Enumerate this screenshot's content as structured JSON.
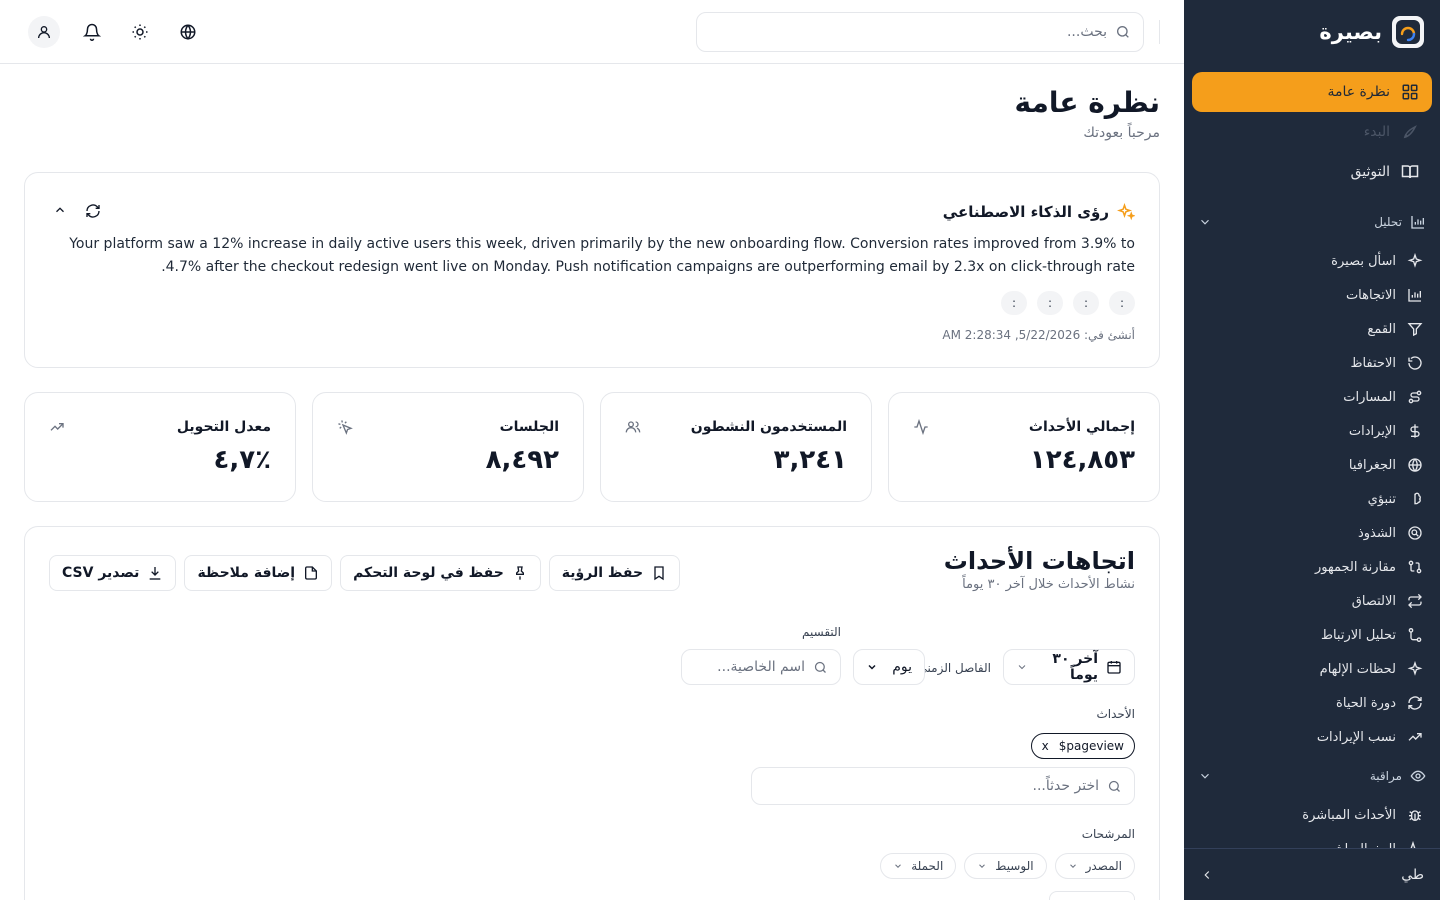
{
  "app": {
    "name": "بصيرة"
  },
  "colors": {
    "accent": "#f59e1b",
    "sidebar_bg": "#1f2a3b"
  },
  "nav": {
    "items": [
      {
        "label": "نظرة عامة",
        "icon": "grid-icon",
        "active": true
      },
      {
        "label": "البدء",
        "icon": "rocket-icon",
        "dim": true
      },
      {
        "label": "التوثيق",
        "icon": "book-icon"
      }
    ],
    "sections": [
      {
        "title": "تحليل",
        "icon": "bar-chart-icon",
        "items": [
          {
            "label": "اسأل بصيرة",
            "icon": "sparkle-icon"
          },
          {
            "label": "الاتجاهات",
            "icon": "bar-chart-icon"
          },
          {
            "label": "القمع",
            "icon": "funnel-icon"
          },
          {
            "label": "الاحتفاظ",
            "icon": "rotate-icon"
          },
          {
            "label": "المسارات",
            "icon": "route-icon"
          },
          {
            "label": "الإيرادات",
            "icon": "dollar-icon"
          },
          {
            "label": "الجغرافيا",
            "icon": "globe-icon"
          },
          {
            "label": "تنبؤي",
            "icon": "brain-icon"
          },
          {
            "label": "الشذوذ",
            "icon": "scan-icon"
          },
          {
            "label": "مقارنة الجمهور",
            "icon": "compare-icon"
          },
          {
            "label": "الالتصاق",
            "icon": "repeat-icon"
          },
          {
            "label": "تحليل الارتباط",
            "icon": "correlation-icon"
          },
          {
            "label": "لحظات الإلهام",
            "icon": "sparkle-icon"
          },
          {
            "label": "دورة الحياة",
            "icon": "refresh-icon"
          },
          {
            "label": "نسب الإيرادات",
            "icon": "trending-up-icon"
          }
        ]
      },
      {
        "title": "مراقبة",
        "icon": "eye-icon",
        "items": [
          {
            "label": "الأحداث المباشرة",
            "icon": "bug-icon"
          },
          {
            "label": "البث المباشر",
            "icon": "activity-icon"
          }
        ]
      }
    ],
    "footer_label": "طي"
  },
  "topbar": {
    "search_placeholder": "بحث..."
  },
  "page": {
    "title": "نظرة عامة",
    "subtitle": "مرحباً بعودتك"
  },
  "ai": {
    "title": "رؤى الذكاء الاصطناعي",
    "text": "Your platform saw a 12% increase in daily active users this week, driven primarily by the new onboarding flow. Conversion rates improved from 3.9% to 4.7% after the checkout redesign went live on Monday. Push notification campaigns are outperforming email by 2.3x on click-through rate.",
    "pills": [
      ":",
      ":",
      ":",
      ":"
    ],
    "created": "أنشئ في: 5/22/2026, 2:28:34 AM"
  },
  "stats": [
    {
      "label": "إجمالي الأحداث",
      "value": "١٢٤,٨٥٣",
      "icon": "activity-icon"
    },
    {
      "label": "المستخدمون النشطون",
      "value": "٣,٢٤١",
      "icon": "users-icon"
    },
    {
      "label": "الجلسات",
      "value": "٨,٤٩٢",
      "icon": "pointer-click-icon"
    },
    {
      "label": "معدل التحويل",
      "value": "٪٤,٧",
      "icon": "trending-up-icon"
    }
  ],
  "trends": {
    "title": "اتجاهات الأحداث",
    "subtitle": "نشاط الأحداث خلال آخر ٣٠ يوماً",
    "buttons": {
      "save_view": "حفظ الرؤية",
      "save_dashboard": "حفظ في لوحة التحكم",
      "add_note": "إضافة ملاحظة",
      "export_csv": "تصدير CSV"
    },
    "date_range": "آخر ٣٠ يوماً",
    "interval_label": "الفاصل الزمني",
    "interval_value": "يوم",
    "split_label": "التقسيم",
    "split_placeholder": "اسم الخاصية...",
    "events_label": "الأحداث",
    "event_chip": "$pageview",
    "event_chip_remove": "x",
    "event_placeholder": "اختر حدثاً...",
    "filters_label": "المرشحات",
    "filters": [
      "المصدر",
      "الوسيط",
      "الحملة"
    ]
  }
}
